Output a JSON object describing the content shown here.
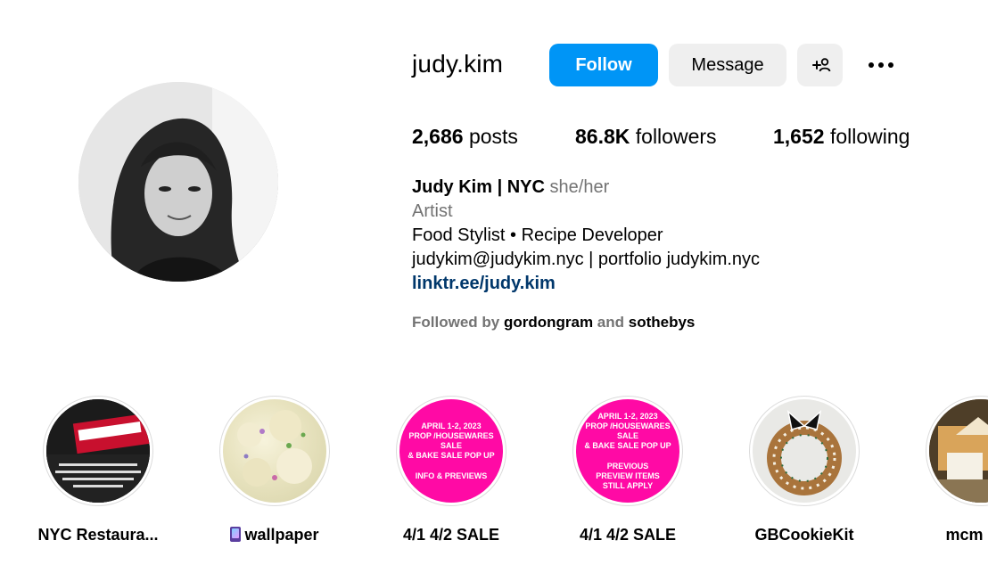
{
  "profile": {
    "username": "judy.kim",
    "follow_label": "Follow",
    "message_label": "Message",
    "stats": {
      "posts_count": "2,686",
      "posts_label": " posts",
      "followers_count": "86.8K",
      "followers_label": " followers",
      "following_count": "1,652",
      "following_label": " following"
    },
    "bio": {
      "name": "Judy Kim | NYC",
      "pronouns": "she/her",
      "category": "Artist",
      "description": "Food Stylist • Recipe Developer",
      "contact": "judykim@judykim.nyc | portfolio judykim.nyc",
      "link": "linktr.ee/judy.kim"
    },
    "followed_by": {
      "prefix": "Followed by ",
      "account1": "gordongram",
      "joiner": " and ",
      "account2": "sothebys"
    }
  },
  "highlights": [
    {
      "label": "NYC Restaura..."
    },
    {
      "label": "wallpaper",
      "emoji": "mobile-phone-icon"
    },
    {
      "label": "4/1 4/2 SALE",
      "cover_lines": [
        "APRIL 1-2, 2023",
        "PROP /HOUSEWARES SALE",
        "& BAKE SALE POP UP",
        "INFO & PREVIEWS"
      ]
    },
    {
      "label": "4/1 4/2 SALE",
      "cover_lines": [
        "APRIL 1-2, 2023",
        "PROP /HOUSEWARES SALE",
        "& BAKE SALE POP UP",
        "PREVIOUS",
        "PREVIEW ITEMS",
        "STILL APPLY"
      ]
    },
    {
      "label": "GBCookieKit"
    },
    {
      "label": "mcm coo"
    }
  ],
  "colors": {
    "follow_blue": "#0095f6",
    "link_blue": "#00376b",
    "muted": "#737373",
    "highlight_pink": "#ff0aa5"
  }
}
